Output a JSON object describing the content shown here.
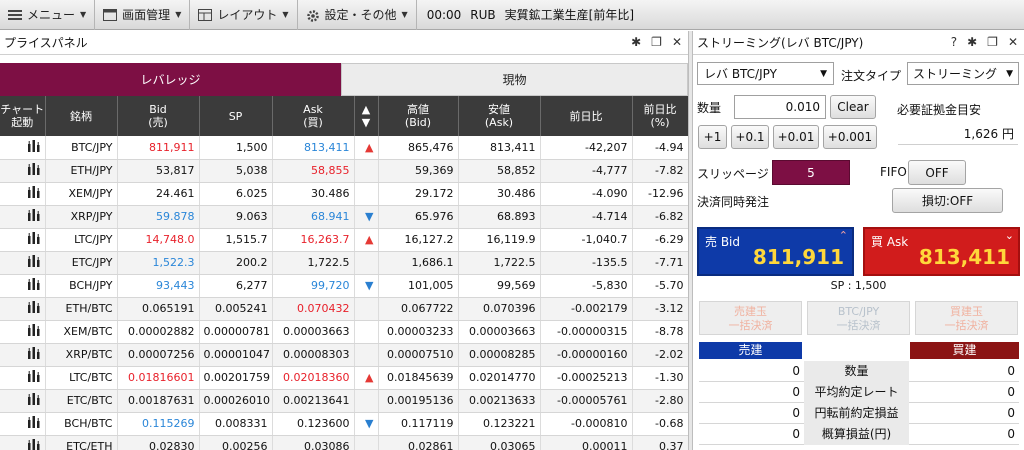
{
  "menubar": {
    "items": [
      {
        "label": "メニュー",
        "icon": "menu-icon"
      },
      {
        "label": "画面管理",
        "icon": "window-icon"
      },
      {
        "label": "レイアウト",
        "icon": "layout-icon"
      },
      {
        "label": "設定・その他",
        "icon": "gear-icon"
      }
    ],
    "ticker": {
      "time": "00:00",
      "currency": "RUB",
      "text": "実質鉱工業生産[前年比]"
    }
  },
  "price_panel": {
    "title": "プライスパネル",
    "tabs": {
      "leverage": "レバレッジ",
      "spot": "現物"
    },
    "columns": {
      "chart": [
        "チャート",
        "起動"
      ],
      "symbol": "銘柄",
      "bid": [
        "Bid",
        "(売)"
      ],
      "sp": "SP",
      "ask": [
        "Ask",
        "(買)"
      ],
      "arrows": [
        "▲",
        "▼"
      ],
      "high": [
        "高値",
        "(Bid)"
      ],
      "low": [
        "安値",
        "(Ask)"
      ],
      "change": "前日比",
      "change_pct": [
        "前日比",
        "(%)"
      ]
    },
    "rows": [
      {
        "symbol": "BTC/JPY",
        "bid": "811,911",
        "sp": "1,500",
        "ask": "813,411",
        "dir": "up",
        "bid_color": "red",
        "ask_color": "blue",
        "high": "865,476",
        "low": "813,411",
        "change": "-42,207",
        "change_pct": "-4.94"
      },
      {
        "symbol": "ETH/JPY",
        "bid": "53,817",
        "sp": "5,038",
        "ask": "58,855",
        "dir": "",
        "bid_color": "",
        "ask_color": "red",
        "high": "59,369",
        "low": "58,852",
        "change": "-4,777",
        "change_pct": "-7.82"
      },
      {
        "symbol": "XEM/JPY",
        "bid": "24.461",
        "sp": "6.025",
        "ask": "30.486",
        "dir": "",
        "bid_color": "",
        "ask_color": "",
        "high": "29.172",
        "low": "30.486",
        "change": "-4.090",
        "change_pct": "-12.96"
      },
      {
        "symbol": "XRP/JPY",
        "bid": "59.878",
        "sp": "9.063",
        "ask": "68.941",
        "dir": "down",
        "bid_color": "blue",
        "ask_color": "blue",
        "high": "65.976",
        "low": "68.893",
        "change": "-4.714",
        "change_pct": "-6.82"
      },
      {
        "symbol": "LTC/JPY",
        "bid": "14,748.0",
        "sp": "1,515.7",
        "ask": "16,263.7",
        "dir": "up",
        "bid_color": "red",
        "ask_color": "red",
        "high": "16,127.2",
        "low": "16,119.9",
        "change": "-1,040.7",
        "change_pct": "-6.29"
      },
      {
        "symbol": "ETC/JPY",
        "bid": "1,522.3",
        "sp": "200.2",
        "ask": "1,722.5",
        "dir": "",
        "bid_color": "blue",
        "ask_color": "",
        "high": "1,686.1",
        "low": "1,722.5",
        "change": "-135.5",
        "change_pct": "-7.71"
      },
      {
        "symbol": "BCH/JPY",
        "bid": "93,443",
        "sp": "6,277",
        "ask": "99,720",
        "dir": "down",
        "bid_color": "blue",
        "ask_color": "blue",
        "high": "101,005",
        "low": "99,569",
        "change": "-5,830",
        "change_pct": "-5.70"
      },
      {
        "symbol": "ETH/BTC",
        "bid": "0.065191",
        "sp": "0.005241",
        "ask": "0.070432",
        "dir": "",
        "bid_color": "",
        "ask_color": "red",
        "high": "0.067722",
        "low": "0.070396",
        "change": "-0.002179",
        "change_pct": "-3.12"
      },
      {
        "symbol": "XEM/BTC",
        "bid": "0.00002882",
        "sp": "0.00000781",
        "ask": "0.00003663",
        "dir": "",
        "bid_color": "",
        "ask_color": "",
        "high": "0.00003233",
        "low": "0.00003663",
        "change": "-0.00000315",
        "change_pct": "-8.78"
      },
      {
        "symbol": "XRP/BTC",
        "bid": "0.00007256",
        "sp": "0.00001047",
        "ask": "0.00008303",
        "dir": "",
        "bid_color": "",
        "ask_color": "",
        "high": "0.00007510",
        "low": "0.00008285",
        "change": "-0.00000160",
        "change_pct": "-2.02"
      },
      {
        "symbol": "LTC/BTC",
        "bid": "0.01816601",
        "sp": "0.00201759",
        "ask": "0.02018360",
        "dir": "up",
        "bid_color": "red",
        "ask_color": "red",
        "high": "0.01845639",
        "low": "0.02014770",
        "change": "-0.00025213",
        "change_pct": "-1.30"
      },
      {
        "symbol": "ETC/BTC",
        "bid": "0.00187631",
        "sp": "0.00026010",
        "ask": "0.00213641",
        "dir": "",
        "bid_color": "",
        "ask_color": "",
        "high": "0.00195136",
        "low": "0.00213633",
        "change": "-0.00005761",
        "change_pct": "-2.80"
      },
      {
        "symbol": "BCH/BTC",
        "bid": "0.115269",
        "sp": "0.008331",
        "ask": "0.123600",
        "dir": "down",
        "bid_color": "blue",
        "ask_color": "",
        "high": "0.117119",
        "low": "0.123221",
        "change": "-0.000810",
        "change_pct": "-0.68"
      },
      {
        "symbol": "ETC/ETH",
        "bid": "0.02830",
        "sp": "0.00256",
        "ask": "0.03086",
        "dir": "",
        "bid_color": "",
        "ask_color": "",
        "high": "0.02861",
        "low": "0.03065",
        "change": "0.00011",
        "change_pct": "0.37"
      }
    ]
  },
  "streaming": {
    "title": "ストリーミング(レバ BTC/JPY)",
    "title_buttons": [
      "?"
    ],
    "pair_select": "レバ BTC/JPY",
    "order_type_label": "注文タイプ",
    "order_type_value": "ストリーミング",
    "qty_label": "数量",
    "qty_value": "0.010",
    "clear_label": "Clear",
    "margin_label": "必要証拠金目安",
    "margin_value": "1,626",
    "margin_unit": "円",
    "step_buttons": [
      "+1",
      "+0.1",
      "+0.01",
      "+0.001"
    ],
    "slippage_label": "スリッページ",
    "slippage_value": "5",
    "fifo_label": "FIFO",
    "fifo_value": "OFF",
    "settle_label": "決済同時発注",
    "stoploss_value": "損切:OFF",
    "sell": {
      "label": "売 Bid",
      "price": "811,911"
    },
    "buy": {
      "label": "買 Ask",
      "price": "813,411"
    },
    "sp_text": "SP : 1,500",
    "bulk": {
      "sell": [
        "売建玉",
        "一括決済"
      ],
      "mid": [
        "BTC/JPY",
        "一括決済"
      ],
      "buy": [
        "買建玉",
        "一括決済"
      ]
    },
    "positions": {
      "sell_header": "売建",
      "buy_header": "買建",
      "rows": [
        {
          "label": "数量",
          "sell": "0",
          "buy": "0"
        },
        {
          "label": "平均約定レート",
          "sell": "0",
          "buy": "0"
        },
        {
          "label": "円転前約定損益",
          "sell": "0",
          "buy": "0"
        },
        {
          "label": "概算損益(円)",
          "sell": "0",
          "buy": "0"
        }
      ]
    }
  },
  "colors": {
    "accent": "#7d0f44",
    "sell": "#0e3aa8",
    "buy": "#d11c1c",
    "up": "#e53935",
    "down": "#2a7fd0"
  }
}
